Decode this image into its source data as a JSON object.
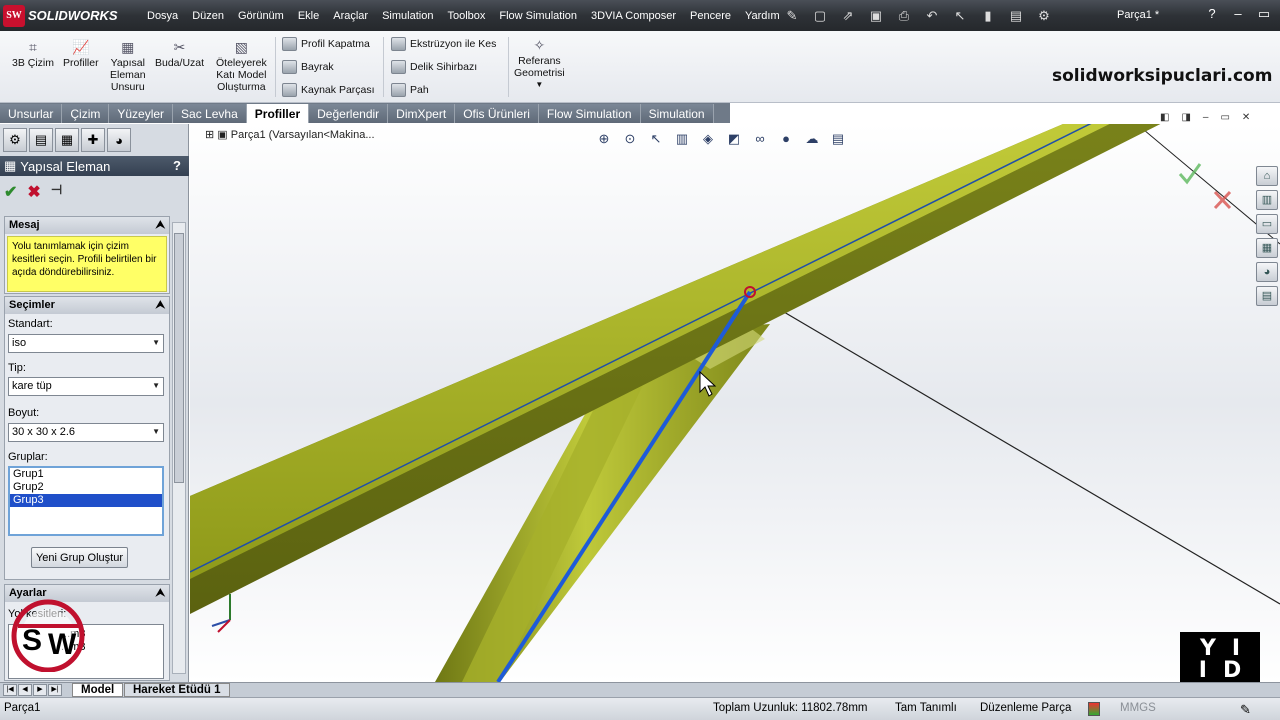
{
  "app": {
    "name": "SOLIDWORKS",
    "document": "Parça1 *"
  },
  "menu": [
    "Dosya",
    "Düzen",
    "Görünüm",
    "Ekle",
    "Araçlar",
    "Simulation",
    "Toolbox",
    "Flow Simulation",
    "3DVIA Composer",
    "Pencere",
    "Yardım"
  ],
  "ribbon": {
    "sketch3d": "3B Çizim",
    "profiles": "Profiller",
    "structural": [
      "Yapısal",
      "Eleman",
      "Unsuru"
    ],
    "trim": "Buda/Uzat",
    "extend_solid": [
      "Öteleyerek",
      "Katı Model",
      "Oluşturma"
    ],
    "end_cap": "Profil Kapatma",
    "gusset": "Bayrak",
    "weld": "Kaynak Parçası",
    "extrude_cut": "Ekstrüzyon ile Kes",
    "hole_wizard": "Delik Sihirbazı",
    "chamfer": "Pah",
    "ref_geometry": [
      "Referans",
      "Geometrisi"
    ],
    "brand": "solidworksipuclari.com"
  },
  "tabs": [
    {
      "label": "Unsurlar",
      "active": false
    },
    {
      "label": "Çizim",
      "active": false
    },
    {
      "label": "Yüzeyler",
      "active": false
    },
    {
      "label": "Sac Levha",
      "active": false
    },
    {
      "label": "Profiller",
      "active": true
    },
    {
      "label": "Değerlendir",
      "active": false
    },
    {
      "label": "DimXpert",
      "active": false
    },
    {
      "label": "Ofis Ürünleri",
      "active": false
    },
    {
      "label": "Flow Simulation",
      "active": false
    },
    {
      "label": "Simulation",
      "active": false
    }
  ],
  "pm": {
    "title": "Yapısal Eleman",
    "help": "?",
    "message_header": "Mesaj",
    "message": "Yolu tanımlamak için çizim kesitleri seçin. Profili belirtilen bir açıda döndürebilirsiniz.",
    "selections_header": "Seçimler",
    "standard_label": "Standart:",
    "standard_value": "iso",
    "type_label": "Tip:",
    "type_value": "kare tüp",
    "size_label": "Boyut:",
    "size_value": "30 x 30 x 2.6",
    "groups_label": "Gruplar:",
    "groups": [
      "Grup1",
      "Grup2",
      "Grup3"
    ],
    "selected_group": "Grup3",
    "new_group_button": "Yeni Grup Oluştur",
    "settings_header": "Ayarlar",
    "path_segments_label": "Yol kesitleri:",
    "path_segments": [
      "...m3",
      "...m3"
    ]
  },
  "viewport": {
    "feature_tree": "Parça1  (Varsayılan<Makina..."
  },
  "bottom_tabs": [
    "Model",
    "Hareket Etüdü 1"
  ],
  "status": {
    "left": "Parça1",
    "total_length": "Toplam Uzunluk: 11802.78mm",
    "defined": "Tam Tanımlı",
    "mode": "Düzenleme Parça",
    "units": "MMGS"
  },
  "watermark": {
    "top": [
      "Y",
      "I"
    ],
    "bottom": [
      "I",
      "D"
    ]
  },
  "colors": {
    "beam": "#8f9a1a",
    "path_line": "#1e5bd8",
    "menubar": "#2e3237"
  }
}
